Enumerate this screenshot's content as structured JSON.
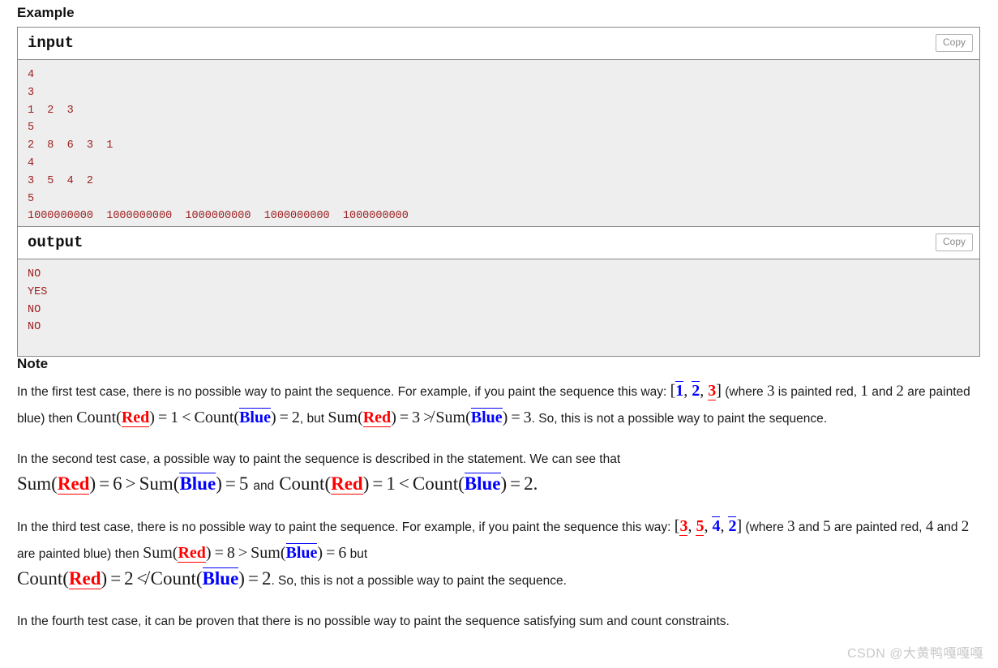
{
  "sections": {
    "example_title": "Example",
    "note_title": "Note"
  },
  "samples": [
    {
      "io_label": "input",
      "copy_label": "Copy",
      "content": "4\n3\n1  2  3\n5\n2  8  6  3  1\n4\n3  5  4  2\n5\n1000000000  1000000000  1000000000  1000000000  1000000000"
    },
    {
      "io_label": "output",
      "copy_label": "Copy",
      "content": "NO\nYES\nNO\nNO"
    }
  ],
  "note": {
    "p1": {
      "t1": "In the first test case, there is no possible way to paint the sequence. For example, if you paint the sequence this way: ",
      "seq_open": "[",
      "seq_1": "1",
      "seq_sep1": ", ",
      "seq_2": "2",
      "seq_sep2": ", ",
      "seq_3": "3",
      "seq_close": "]",
      "t2": " (where ",
      "n3": "3",
      "t3": " is painted red, ",
      "n1": "1",
      "t4": " and ",
      "n2": "2",
      "t5": " are painted blue) then ",
      "count1_fn": "Count(",
      "count1_red": "Red",
      "count1_close": ")",
      "eq1": "=",
      "v1": "1",
      "lt1": "<",
      "count2_fn": "Count(",
      "count2_blue": "Blue",
      "count2_close": ")",
      "eq2": "=",
      "v2": "2",
      "t6": ", but ",
      "sum1_fn": "Sum(",
      "sum1_red": "Red",
      "sum1_close": ")",
      "eq3": "=",
      "v3": "3",
      "ngt": "≯",
      "sum2_fn": "Sum(",
      "sum2_blue": "Blue",
      "sum2_close": ")",
      "eq4": "=",
      "v4": "3",
      "t7": ". So, this is not a possible way to paint the sequence."
    },
    "p2": {
      "t1": "In the second test case, a possible way to paint the sequence is described in the statement. We can see that",
      "sum1_fn": "Sum(",
      "sum1_red": "Red",
      "sum1_close": ")",
      "eq1": "=",
      "v1": "6",
      "gt1": ">",
      "sum2_fn": "Sum(",
      "sum2_blue": "Blue",
      "sum2_close": ")",
      "eq2": "=",
      "v2": "5",
      "and": "and",
      "count1_fn": "Count(",
      "count1_red": "Red",
      "count1_close": ")",
      "eq3": "=",
      "v3": "1",
      "lt1": "<",
      "count2_fn": "Count(",
      "count2_blue": "Blue",
      "count2_close": ")",
      "eq4": "=",
      "v4": "2",
      "period": "."
    },
    "p3": {
      "t1": "In the third test case, there is no possible way to paint the sequence. For example, if you paint the sequence this way: ",
      "seq_open": "[",
      "seq_1": "3",
      "seq_sep1": ", ",
      "seq_2": "5",
      "seq_sep2": ", ",
      "seq_3": "4",
      "seq_sep3": ", ",
      "seq_4": "2",
      "seq_close": "]",
      "t2": " (where ",
      "n3": "3",
      "t3": " and ",
      "n5": "5",
      "t4": " are painted red, ",
      "n4": "4",
      "t5": " and ",
      "n2": "2",
      "t6": " are painted blue) then ",
      "sum1_fn": "Sum(",
      "sum1_red": "Red",
      "sum1_close": ")",
      "eq1": "=",
      "v1": "8",
      "gt1": ">",
      "sum2_fn": "Sum(",
      "sum2_blue": "Blue",
      "sum2_close": ")",
      "eq2": "=",
      "v2": "6",
      "t7": " but ",
      "count1_fn": "Count(",
      "count1_red": "Red",
      "count1_close": ")",
      "eq3": "=",
      "v3": "2",
      "nlt": "≮",
      "count2_fn": "Count(",
      "count2_blue": "Blue",
      "count2_close": ")",
      "eq4": "=",
      "v4": "2",
      "t8": ". So, this is not a possible way to paint the sequence."
    },
    "p4": {
      "t1": "In the fourth test case, it can be proven that there is no possible way to paint the sequence satisfying sum and count constraints."
    }
  },
  "watermark": "CSDN @大黄鸭嘎嘎嘎",
  "colors": {
    "red": "#ff0000",
    "blue": "#0000ff",
    "code_text": "#9c2020",
    "code_bg": "#eeeeee",
    "border": "#888888"
  }
}
